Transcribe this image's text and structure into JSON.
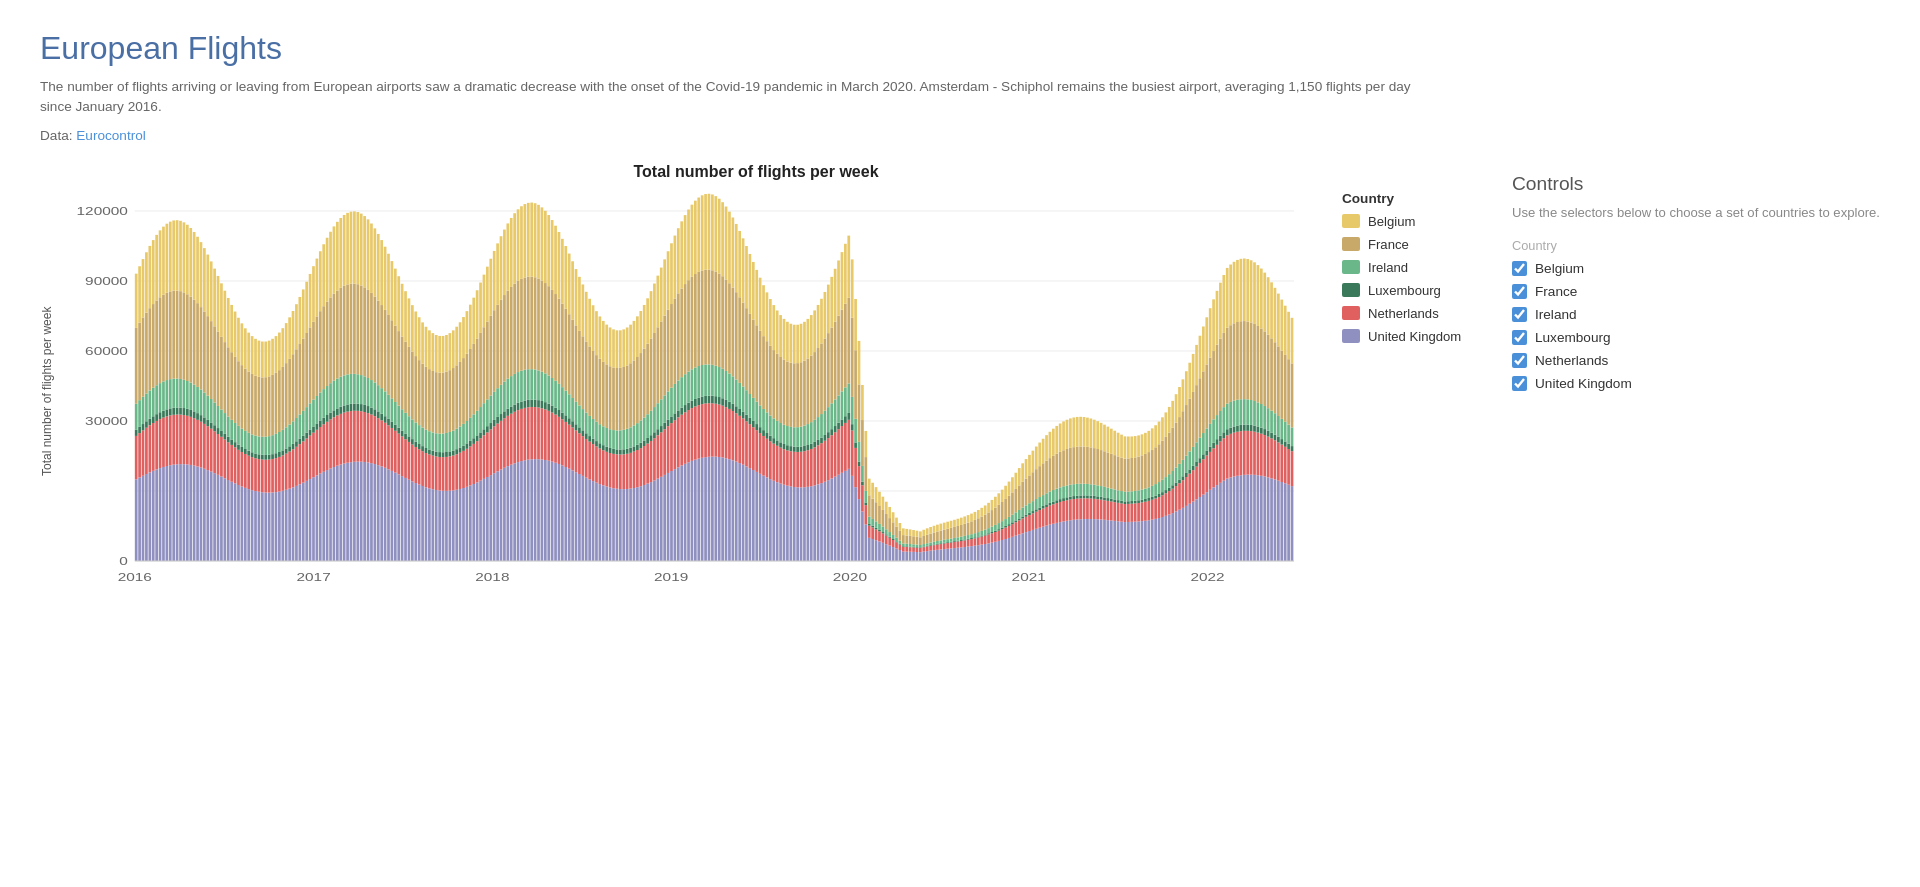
{
  "page": {
    "title": "European Flights",
    "subtitle": "The number of flights arriving or leaving from European airports saw a dramatic decrease with the onset of the Covid-19 pandemic in March 2020. Amsterdam - Schiphol remains the busiest airport, averaging 1,150 flights per day since January 2016.",
    "data_source_label": "Data:",
    "data_source_link_text": "Eurocontrol",
    "data_source_url": "#"
  },
  "chart": {
    "title": "Total number of flights per week",
    "y_axis_label": "Total number of flights per week",
    "y_ticks": [
      "0",
      "30000",
      "60000",
      "90000",
      "120000"
    ],
    "x_labels": [
      "2016",
      "2017",
      "2018",
      "2019",
      "2020",
      "2021",
      "2022"
    ]
  },
  "legend": {
    "title": "Country",
    "items": [
      {
        "label": "Belgium",
        "color": "#e8c96a"
      },
      {
        "label": "France",
        "color": "#c8a96a"
      },
      {
        "label": "Ireland",
        "color": "#6ab88a"
      },
      {
        "label": "Luxembourg",
        "color": "#3a7a5a"
      },
      {
        "label": "Netherlands",
        "color": "#e06060"
      },
      {
        "label": "United Kingdom",
        "color": "#9090c0"
      }
    ]
  },
  "controls": {
    "title": "Controls",
    "subtitle": "Use the selectors below to choose a set of countries to explore.",
    "country_label": "Country",
    "checkboxes": [
      {
        "label": "Belgium",
        "checked": true
      },
      {
        "label": "France",
        "checked": true
      },
      {
        "label": "Ireland",
        "checked": true
      },
      {
        "label": "Luxembourg",
        "checked": true
      },
      {
        "label": "Netherlands",
        "checked": true
      },
      {
        "label": "United Kingdom",
        "checked": true
      }
    ]
  }
}
